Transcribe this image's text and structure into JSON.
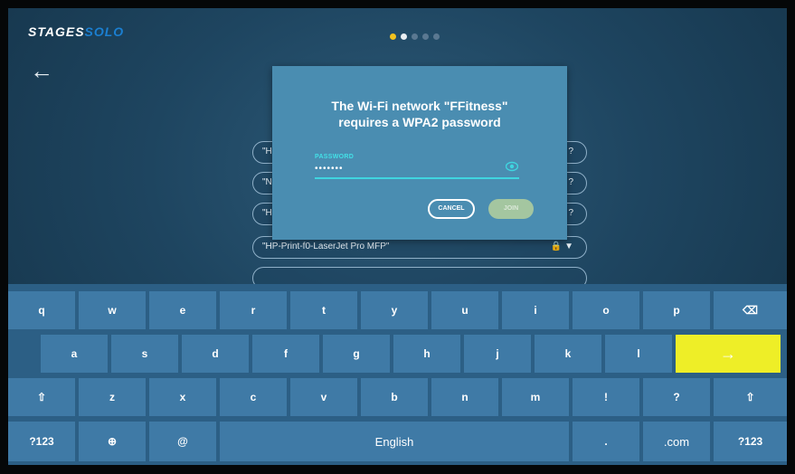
{
  "header": {
    "logo_part1": "STAGES",
    "logo_part2": "SOLO",
    "back_icon": "arrow-left-icon",
    "pager_dots": 5,
    "pager_active_index": 0
  },
  "networks": [
    {
      "label": "\"H",
      "icons": "?"
    },
    {
      "label": "\"N",
      "icons": "?"
    },
    {
      "label": "\"H",
      "icons": "?"
    },
    {
      "label": "\"HP-Print-f0-LaserJet Pro MFP\"",
      "icons": "🔒 ▼"
    },
    {
      "label": "",
      "icons": ""
    }
  ],
  "dialog": {
    "title_line1": "The Wi-Fi network \"FFitness\"",
    "title_line2": "requires a WPA2 password",
    "password_label": "PASSWORD",
    "password_value": "•••••••",
    "show_password_icon": "eye-icon",
    "cancel_label": "CANCEL",
    "join_label": "JOIN"
  },
  "keyboard": {
    "row1": [
      "q",
      "w",
      "e",
      "r",
      "t",
      "y",
      "u",
      "i",
      "o",
      "p",
      "⌫"
    ],
    "row2": [
      "a",
      "s",
      "d",
      "f",
      "g",
      "h",
      "j",
      "k",
      "l",
      "→"
    ],
    "row3": [
      "⇧",
      "z",
      "x",
      "c",
      "v",
      "b",
      "n",
      "m",
      "!",
      "?",
      "⇧"
    ],
    "row4": [
      "?123",
      "⊕",
      "@",
      "English",
      ".",
      ".com",
      "?123"
    ],
    "enter_color": "#eeee27"
  },
  "colors": {
    "accent": "#3fd5e0",
    "dialog_bg": "#4a8db1",
    "keyboard_bg": "#2c5f85",
    "key_bg": "#3f7aa6",
    "logo_blue": "#1b7fd1",
    "pager_active": "#f1c21f"
  }
}
